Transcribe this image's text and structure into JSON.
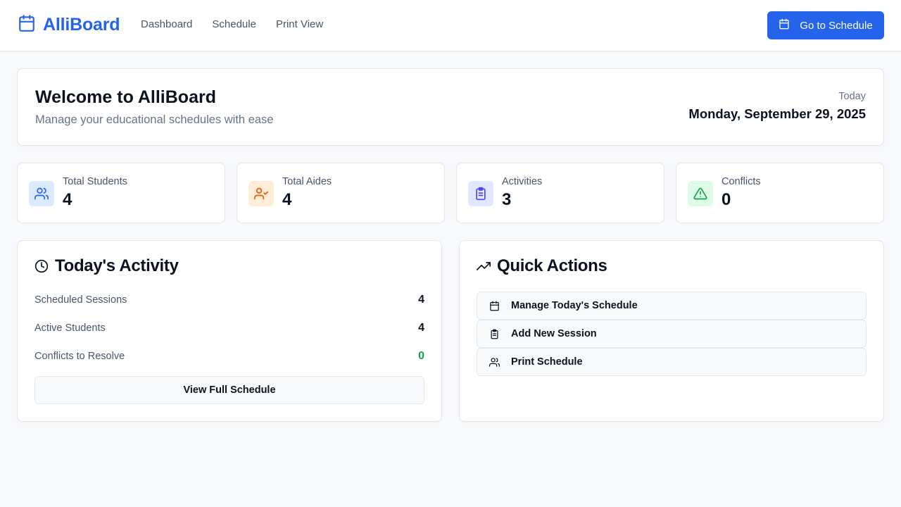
{
  "app": {
    "name": "AlliBoard"
  },
  "nav": {
    "items": [
      "Dashboard",
      "Schedule",
      "Print View"
    ]
  },
  "header": {
    "cta_label": "Go to Schedule"
  },
  "welcome": {
    "title": "Welcome to AlliBoard",
    "subtitle": "Manage your educational schedules with ease",
    "today_label": "Today",
    "date": "Monday, September 29, 2025"
  },
  "stats": [
    {
      "label": "Total Students",
      "value": "4",
      "icon": "users-icon",
      "tint": "#dbeafe",
      "color": "#2563eb"
    },
    {
      "label": "Total Aides",
      "value": "4",
      "icon": "user-check-icon",
      "tint": "#ffedd5",
      "color": "#ea580c"
    },
    {
      "label": "Activities",
      "value": "3",
      "icon": "clipboard-icon",
      "tint": "#e0e7ff",
      "color": "#4f46e5"
    },
    {
      "label": "Conflicts",
      "value": "0",
      "icon": "alert-triangle-icon",
      "tint": "#dcfce7",
      "color": "#16a34a"
    }
  ],
  "activity": {
    "title": "Today's Activity",
    "rows": [
      {
        "label": "Scheduled Sessions",
        "value": "4"
      },
      {
        "label": "Active Students",
        "value": "4"
      },
      {
        "label": "Conflicts to Resolve",
        "value": "0"
      }
    ],
    "button": "View Full Schedule"
  },
  "quick_actions": {
    "title": "Quick Actions",
    "items": [
      {
        "label": "Manage Today's Schedule",
        "icon": "calendar-icon"
      },
      {
        "label": "Add New Session",
        "icon": "clipboard-icon"
      },
      {
        "label": "Print Schedule",
        "icon": "users-icon"
      }
    ]
  },
  "colors": {
    "brand": "#2563eb",
    "success": "#16a34a",
    "background": "#f8f9fb"
  }
}
